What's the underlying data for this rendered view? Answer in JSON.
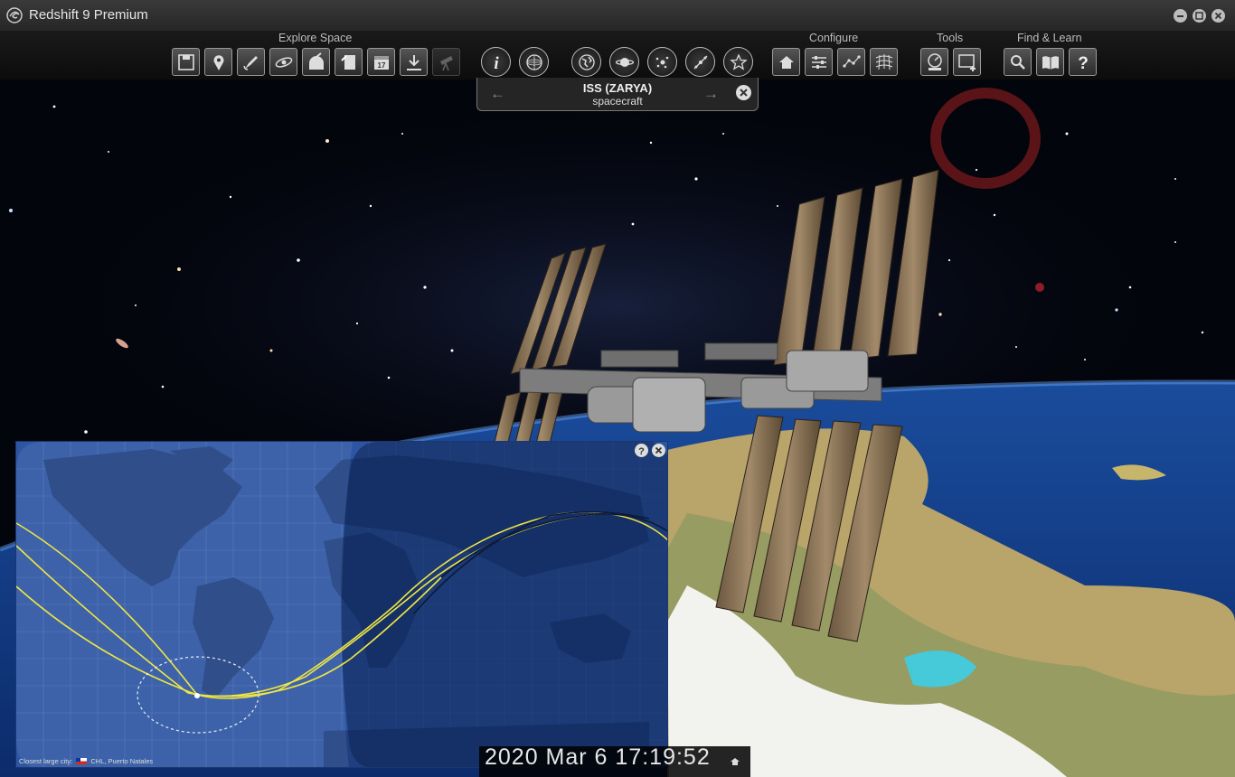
{
  "app": {
    "title": "Redshift 9 Premium"
  },
  "toolbar": {
    "groups": {
      "explore": "Explore Space",
      "configure": "Configure",
      "tools": "Tools",
      "find_learn": "Find & Learn"
    },
    "explore_buttons": [
      "save",
      "location",
      "spacecraft-flight",
      "galaxy-view",
      "observatory",
      "star-sheet",
      "calendar",
      "download",
      "telescope"
    ],
    "center_buttons": [
      "info",
      "sky-chart",
      "earth-globe",
      "saturn",
      "orbit-view",
      "trajectory",
      "favorite-star"
    ],
    "configure_buttons": [
      "home",
      "sliders",
      "constellations",
      "coordinate-grid"
    ],
    "tools_buttons": [
      "eyepiece",
      "add-screen"
    ],
    "find_buttons": [
      "search",
      "book",
      "help"
    ]
  },
  "object_panel": {
    "name": "ISS (ZARYA)",
    "type": "spacecraft",
    "prev": "←",
    "next": "→"
  },
  "ground_track": {
    "footer_prefix": "Closest large city:",
    "closest_city": "CHL, Puerto Natales"
  },
  "time": {
    "display": "2020 Mar 6   17:19:52"
  },
  "colors": {
    "map_ocean": "#2d55a2",
    "orbit_track": "#f0e642",
    "panel_bg": "#282828"
  }
}
